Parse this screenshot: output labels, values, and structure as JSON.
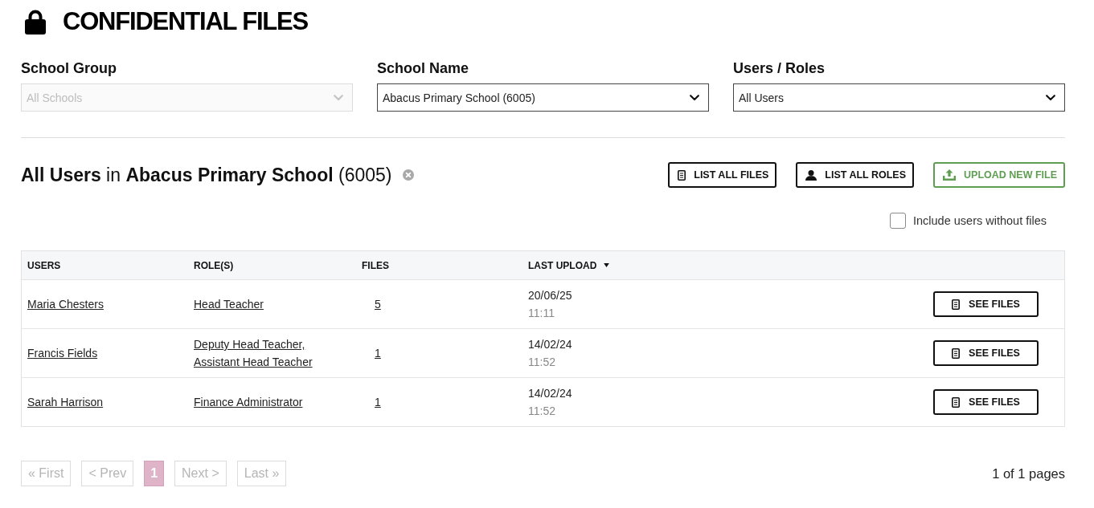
{
  "header": {
    "title": "CONFIDENTIAL FILES"
  },
  "filters": [
    {
      "label": "School Group",
      "value": "All Schools",
      "disabled": true
    },
    {
      "label": "School Name",
      "value": "Abacus Primary School (6005)",
      "disabled": false
    },
    {
      "label": "Users / Roles",
      "value": "All Users",
      "disabled": false
    }
  ],
  "results": {
    "heading": "**All Users** in **Abacus Primary School** (6005)",
    "actions": [
      {
        "label": "LIST ALL FILES",
        "kind": "files"
      },
      {
        "label": "LIST ALL ROLES",
        "kind": "roles"
      },
      {
        "label": "UPLOAD NEW FILE",
        "kind": "upload"
      }
    ],
    "include_users_without_files": {
      "label": "Include users without files",
      "checked": false
    }
  },
  "table": {
    "columns": [
      {
        "label": "USERS",
        "sorted": false
      },
      {
        "label": "ROLE(S)",
        "sorted": false
      },
      {
        "label": "FILES",
        "sorted": false
      },
      {
        "label": "LAST UPLOAD",
        "sorted": true
      }
    ],
    "rows": [
      {
        "user": "Maria Chesters",
        "roles": [
          "Head Teacher"
        ],
        "files": "5",
        "last_upload_date": "20/06/25",
        "last_upload_time": "11:11",
        "action": "SEE FILES"
      },
      {
        "user": "Francis Fields",
        "roles": [
          "Deputy Head Teacher,",
          "Assistant Head Teacher"
        ],
        "files": "1",
        "last_upload_date": "14/02/24",
        "last_upload_time": "11:52",
        "action": "SEE FILES"
      },
      {
        "user": "Sarah Harrison",
        "roles": [
          "Finance Administrator"
        ],
        "files": "1",
        "last_upload_date": "14/02/24",
        "last_upload_time": "11:52",
        "action": "SEE FILES"
      }
    ]
  },
  "pagination": {
    "items": [
      {
        "label": "« First",
        "selected": false,
        "disabled": true
      },
      {
        "label": "< Prev",
        "selected": false,
        "disabled": true
      },
      {
        "label": "1",
        "selected": true,
        "disabled": false
      },
      {
        "label": "Next >",
        "selected": false,
        "disabled": true
      },
      {
        "label": "Last »",
        "selected": false,
        "disabled": true
      }
    ],
    "summary": "1 of 1 pages"
  }
}
